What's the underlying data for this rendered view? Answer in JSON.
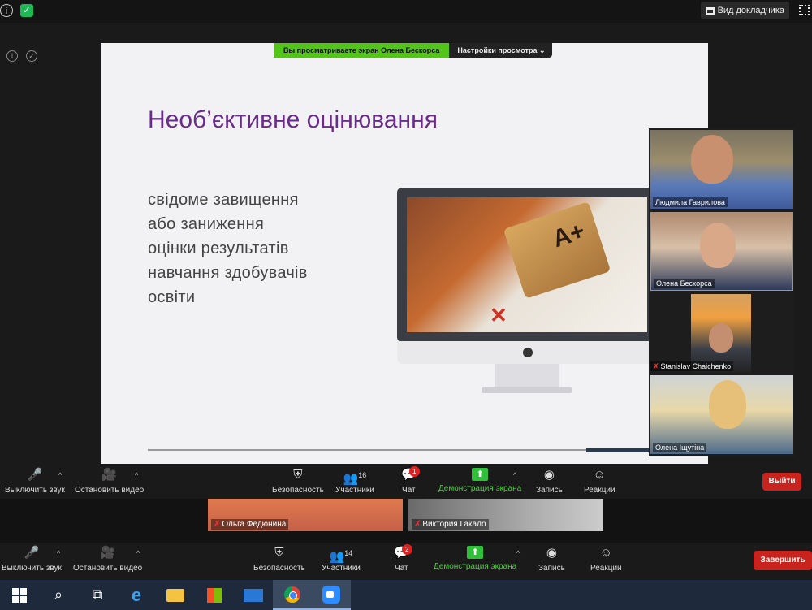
{
  "top": {
    "speaker_view_label": "Вид докладчика"
  },
  "share_banner": {
    "viewing_text": "Вы просматриваете экран Олена Бескорса",
    "view_settings_label": "Настройки просмотра ⌄"
  },
  "slide": {
    "title": "Необ’єктивне оцінювання",
    "body_lines": [
      "свідоме завищення",
      "або заниження",
      "оцінки результатів",
      "навчання здобувачів",
      "освіти"
    ],
    "image_text": "A+",
    "image_mark": "✕"
  },
  "participants": [
    {
      "name": "Людмила Гаврилова",
      "muted": false
    },
    {
      "name": "Олена Бескорса",
      "muted": false
    },
    {
      "name": "Stanislav Chaichenko",
      "muted": true
    },
    {
      "name": "Олена Іщутіна",
      "muted": false
    }
  ],
  "toolbar1": {
    "mute_label": "Выключить звук",
    "video_label": "Остановить видео",
    "security_label": "Безопасность",
    "participants_label": "Участники",
    "participants_count": "16",
    "chat_label": "Чат",
    "chat_badge": "1",
    "share_label": "Демонстрация экрана",
    "record_label": "Запись",
    "reactions_label": "Реакции",
    "leave_label": "Выйти"
  },
  "thumbnails": [
    {
      "name": "Ольга Федюнина"
    },
    {
      "name": "Виктория Гакало"
    }
  ],
  "toolbar2": {
    "mute_label": "Выключить звук",
    "video_label": "Остановить видео",
    "security_label": "Безопасность",
    "participants_label": "Участники",
    "participants_count": "14",
    "chat_label": "Чат",
    "chat_badge": "2",
    "share_label": "Демонстрация экрана",
    "record_label": "Запись",
    "reactions_label": "Реакции",
    "end_label": "Завершить"
  },
  "icons": {
    "mic": "🎤",
    "video": "🎥",
    "shield": "⛨",
    "people": "👥",
    "chat": "💬",
    "share": "⬆",
    "record": "◉",
    "reactions": "☺",
    "search": "⌕",
    "taskview": "⧉",
    "caret": "^",
    "info": "i",
    "mic_off": "✗"
  },
  "colors": {
    "title_purple": "#6a2c8a",
    "share_green": "#52c41a",
    "end_red": "#c9231e"
  }
}
